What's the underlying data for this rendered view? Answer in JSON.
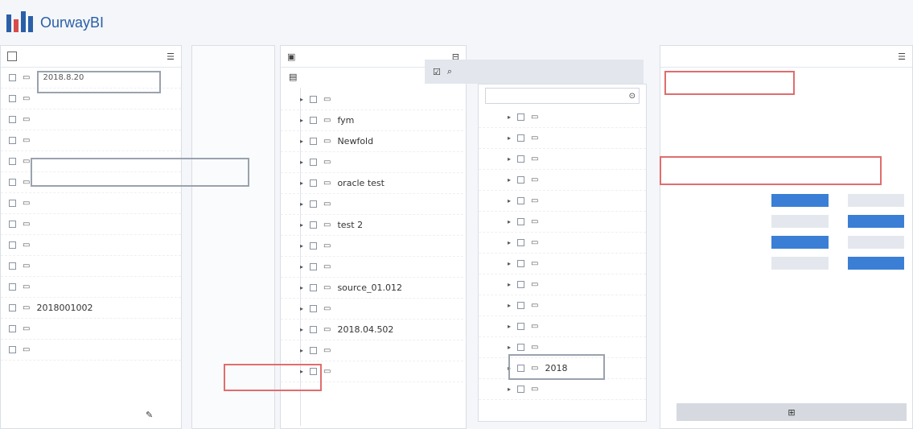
{
  "brand": {
    "name": "OurwayBI"
  },
  "icons": {
    "menu": "menu-icon",
    "search": "search-icon",
    "folder": "folder-icon",
    "checkbox": "checkbox-icon",
    "list": "list-icon",
    "grid": "grid-icon"
  },
  "left_panel": {
    "header": "",
    "rows": [
      {
        "label": "",
        "value": "2018.8.20"
      },
      {
        "label": "",
        "value": ""
      },
      {
        "label": "",
        "value": ""
      },
      {
        "label": "",
        "value": ""
      },
      {
        "label": "",
        "value": ""
      },
      {
        "label": "",
        "value": ""
      },
      {
        "label": "",
        "value": ""
      },
      {
        "label": "",
        "value": ""
      },
      {
        "label": "",
        "value": ""
      }
    ],
    "bottom_rows": [
      "",
      "",
      "2018001002",
      "",
      ""
    ]
  },
  "middle_panel": {
    "items": [
      {
        "label": "",
        "child": ""
      },
      {
        "label": "",
        "child": "fym"
      },
      {
        "label": "",
        "child": "Newfold"
      },
      {
        "label": "",
        "child": ""
      },
      {
        "label": "",
        "child": "oracle test"
      },
      {
        "label": "",
        "child": ""
      },
      {
        "label": "",
        "child": "test 2"
      },
      {
        "label": "",
        "child": ""
      },
      {
        "label": "",
        "child": ""
      },
      {
        "label": "",
        "child": "source_01.012"
      },
      {
        "label": "",
        "child": ""
      },
      {
        "label": "",
        "child": "2018.04.502"
      },
      {
        "label": "",
        "child": ""
      },
      {
        "label": "",
        "child": ""
      }
    ]
  },
  "right_list_panel": {
    "title": "",
    "search_placeholder": "",
    "items": [
      "",
      "",
      "",
      "",
      "",
      "",
      "",
      "",
      "",
      "",
      "",
      "",
      "2018",
      ""
    ]
  },
  "props_panel": {
    "rows": [
      {
        "label": "",
        "value": ""
      },
      {
        "label": "",
        "value": ""
      },
      {
        "label": "",
        "value": ""
      },
      {
        "label": "",
        "value": ""
      },
      {
        "label": "",
        "value": ""
      }
    ],
    "toggles": [
      {
        "label": "",
        "a": "",
        "b": ""
      },
      {
        "label": "",
        "a": "",
        "b": ""
      },
      {
        "label": "",
        "a": "",
        "b": ""
      },
      {
        "label": "",
        "a": "",
        "b": ""
      }
    ],
    "footer_a": "",
    "footer_b": "",
    "bottom_button": ""
  }
}
